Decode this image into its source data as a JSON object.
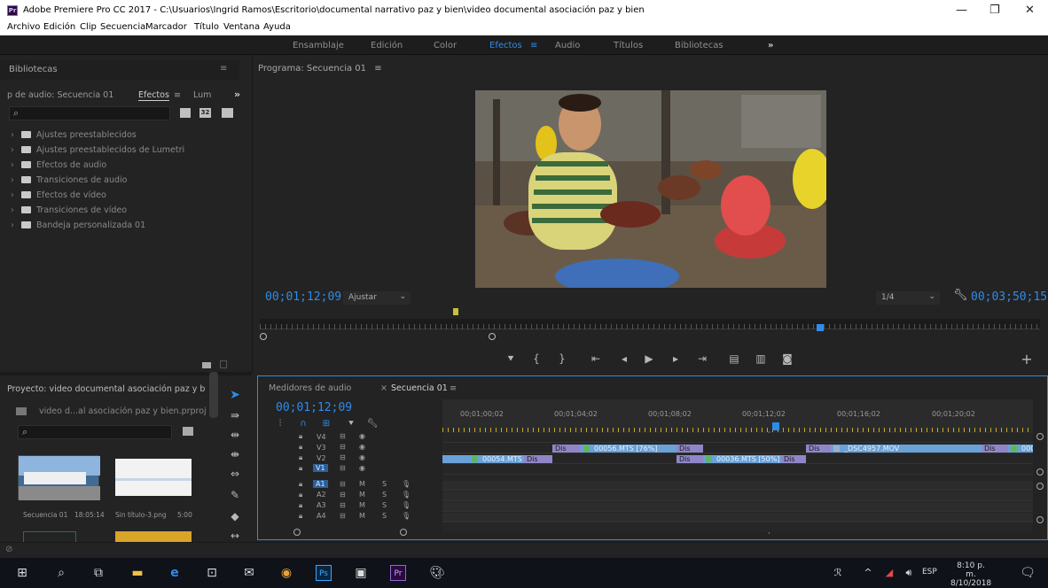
{
  "window": {
    "app_badge": "Pr",
    "title": "Adobe Premiere Pro CC 2017 - C:\\Usuarios\\Ingrid Ramos\\Escritorio\\documental narrativo paz y bien\\video documental asociación paz y bien",
    "minimize": "—",
    "maximize": "❐",
    "close": "✕"
  },
  "menu": [
    "Archivo",
    "Edición",
    "Clip",
    "Secuencia",
    "Marcador",
    "Título",
    "Ventana",
    "Ayuda"
  ],
  "workspaces": {
    "items": [
      "Ensamblaje",
      "Edición",
      "Color",
      "Efectos",
      "Audio",
      "Títulos",
      "Bibliotecas"
    ],
    "active": "Efectos",
    "menu_glyph": "≡",
    "more": "»"
  },
  "effects_panel": {
    "header": "Bibliotecas",
    "tabs": [
      "p de audio: Secuencia 01",
      "Efectos",
      "Lum"
    ],
    "active_tab": "Efectos",
    "search_icon": "⌕",
    "filter_badges": [
      "32"
    ],
    "items": [
      "Ajustes preestablecidos",
      "Ajustes preestablecidos de Lumetri",
      "Efectos de audio",
      "Transiciones de audio",
      "Efectos de vídeo",
      "Transiciones de vídeo",
      "Bandeja personalizada 01"
    ]
  },
  "program_monitor": {
    "title": "Programa: Secuencia 01",
    "current_timecode": "00;01;12;09",
    "fit": "Ajustar",
    "resolution": "1/4",
    "duration": "00;03;50;15",
    "playhead_fraction": 0.333,
    "in_marker_fraction": 0.25
  },
  "project_panel": {
    "title": "Proyecto: video documental asociación paz y bien",
    "file": "video d...al asociación paz y bien.prproj",
    "thumbnails": [
      {
        "label": "Secuencia 01",
        "duration": "18:05:14"
      },
      {
        "label": "Sin título-3.png",
        "duration": "5:00"
      }
    ]
  },
  "timeline": {
    "tabs": [
      "Medidores de audio",
      "Secuencia 01"
    ],
    "active_tab": "Secuencia 01",
    "timecode": "00;01;12;09",
    "ruler": [
      "00;01;00;02",
      "00;01;04;02",
      "00;01;08;02",
      "00;01;12;02",
      "00;01;16;02",
      "00;01;20;02"
    ],
    "video_tracks": [
      "V4",
      "V3",
      "V2",
      "V1"
    ],
    "audio_tracks": [
      "A1",
      "A2",
      "A3",
      "A4"
    ],
    "clips": [
      {
        "track": "V3",
        "name": "00056.MTS [76%]"
      },
      {
        "track": "V3",
        "name": "_DSC4957.MOV"
      },
      {
        "track": "V3",
        "name": "000"
      },
      {
        "track": "V2",
        "name": "00054.MTS"
      },
      {
        "track": "V2",
        "name": "00036.MTS [50%]"
      }
    ],
    "dissolve_label": "Dis"
  },
  "taskbar": {
    "lang": "ESP",
    "time": "8:10 p. m.",
    "date": "8/10/2018"
  }
}
